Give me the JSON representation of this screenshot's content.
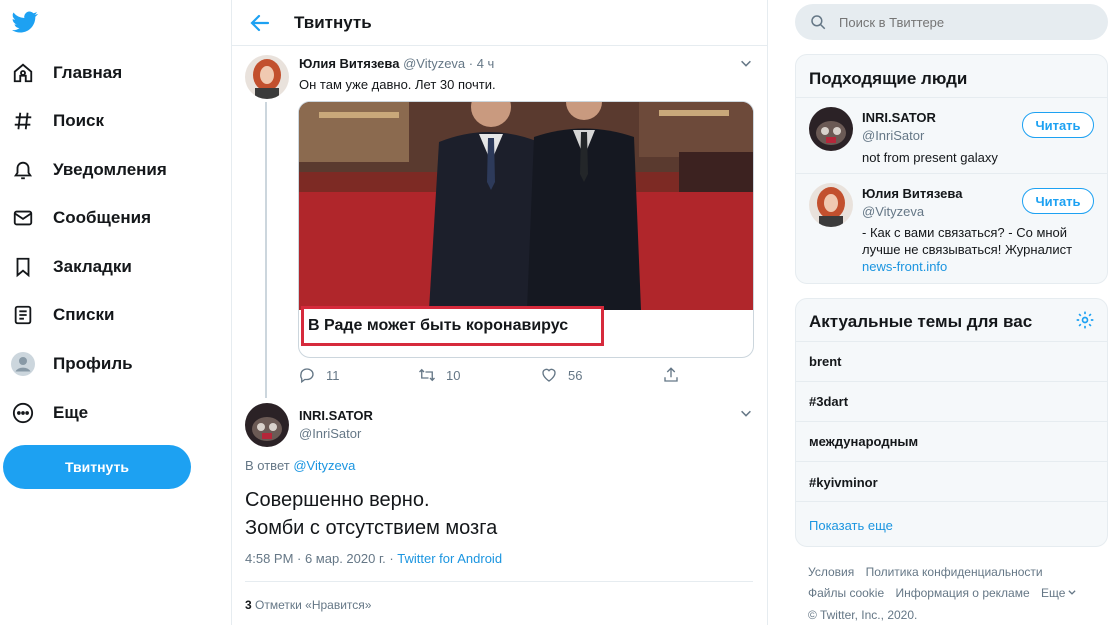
{
  "nav": {
    "items": [
      {
        "label": "Главная"
      },
      {
        "label": "Поиск"
      },
      {
        "label": "Уведомления"
      },
      {
        "label": "Сообщения"
      },
      {
        "label": "Закладки"
      },
      {
        "label": "Списки"
      },
      {
        "label": "Профиль"
      },
      {
        "label": "Еще"
      }
    ],
    "tweet_button": "Твитнуть"
  },
  "header": {
    "title": "Твитнуть"
  },
  "parent_tweet": {
    "author_name": "Юлия Витязева",
    "author_handle": "@Vityzeva",
    "time": " · 4 ч",
    "text": "Он там уже давно. Лет 30 почти.",
    "card_caption": "В Раде может быть коронавирус",
    "replies": "11",
    "retweets": "10",
    "likes": "56"
  },
  "main_tweet": {
    "author_name": "INRI.SATOR",
    "author_handle": "@InriSator",
    "reply_prefix": "В ответ ",
    "reply_handle": "@Vityzeva",
    "line1": "Совершенно верно.",
    "line2": "Зомби с отсутствием мозга",
    "timestamp": "4:58 PM · 6 мар. 2020 г. · ",
    "source": "Twitter for Android",
    "like_count": "3",
    "like_label": " Отметки «Нравится»"
  },
  "search": {
    "placeholder": "Поиск в Твиттере"
  },
  "who_to_follow": {
    "title": "Подходящие люди",
    "people": [
      {
        "name": "INRI.SATOR",
        "handle": "@InriSator",
        "bio": "not from present galaxy",
        "button": "Читать"
      },
      {
        "name": "Юлия Витязева",
        "handle": "@Vityzeva",
        "bio": "- Как с вами связаться? - Со мной лучше не связываться! Журналист",
        "link": "news-front.info",
        "button": "Читать"
      }
    ]
  },
  "trends": {
    "title": "Актуальные темы для вас",
    "items": [
      "brent",
      "#3dart",
      "международным",
      "#kyivminor"
    ],
    "show_more": "Показать еще"
  },
  "footer": {
    "row1": [
      "Условия",
      "Политика конфиденциальности"
    ],
    "row2": [
      "Файлы cookie",
      "Информация о рекламе",
      "Еще"
    ],
    "copyright": "© Twitter, Inc., 2020."
  },
  "colors": {
    "accent": "#1da1f2",
    "link": "#1b95e0",
    "caption_border": "#d62a3c"
  }
}
